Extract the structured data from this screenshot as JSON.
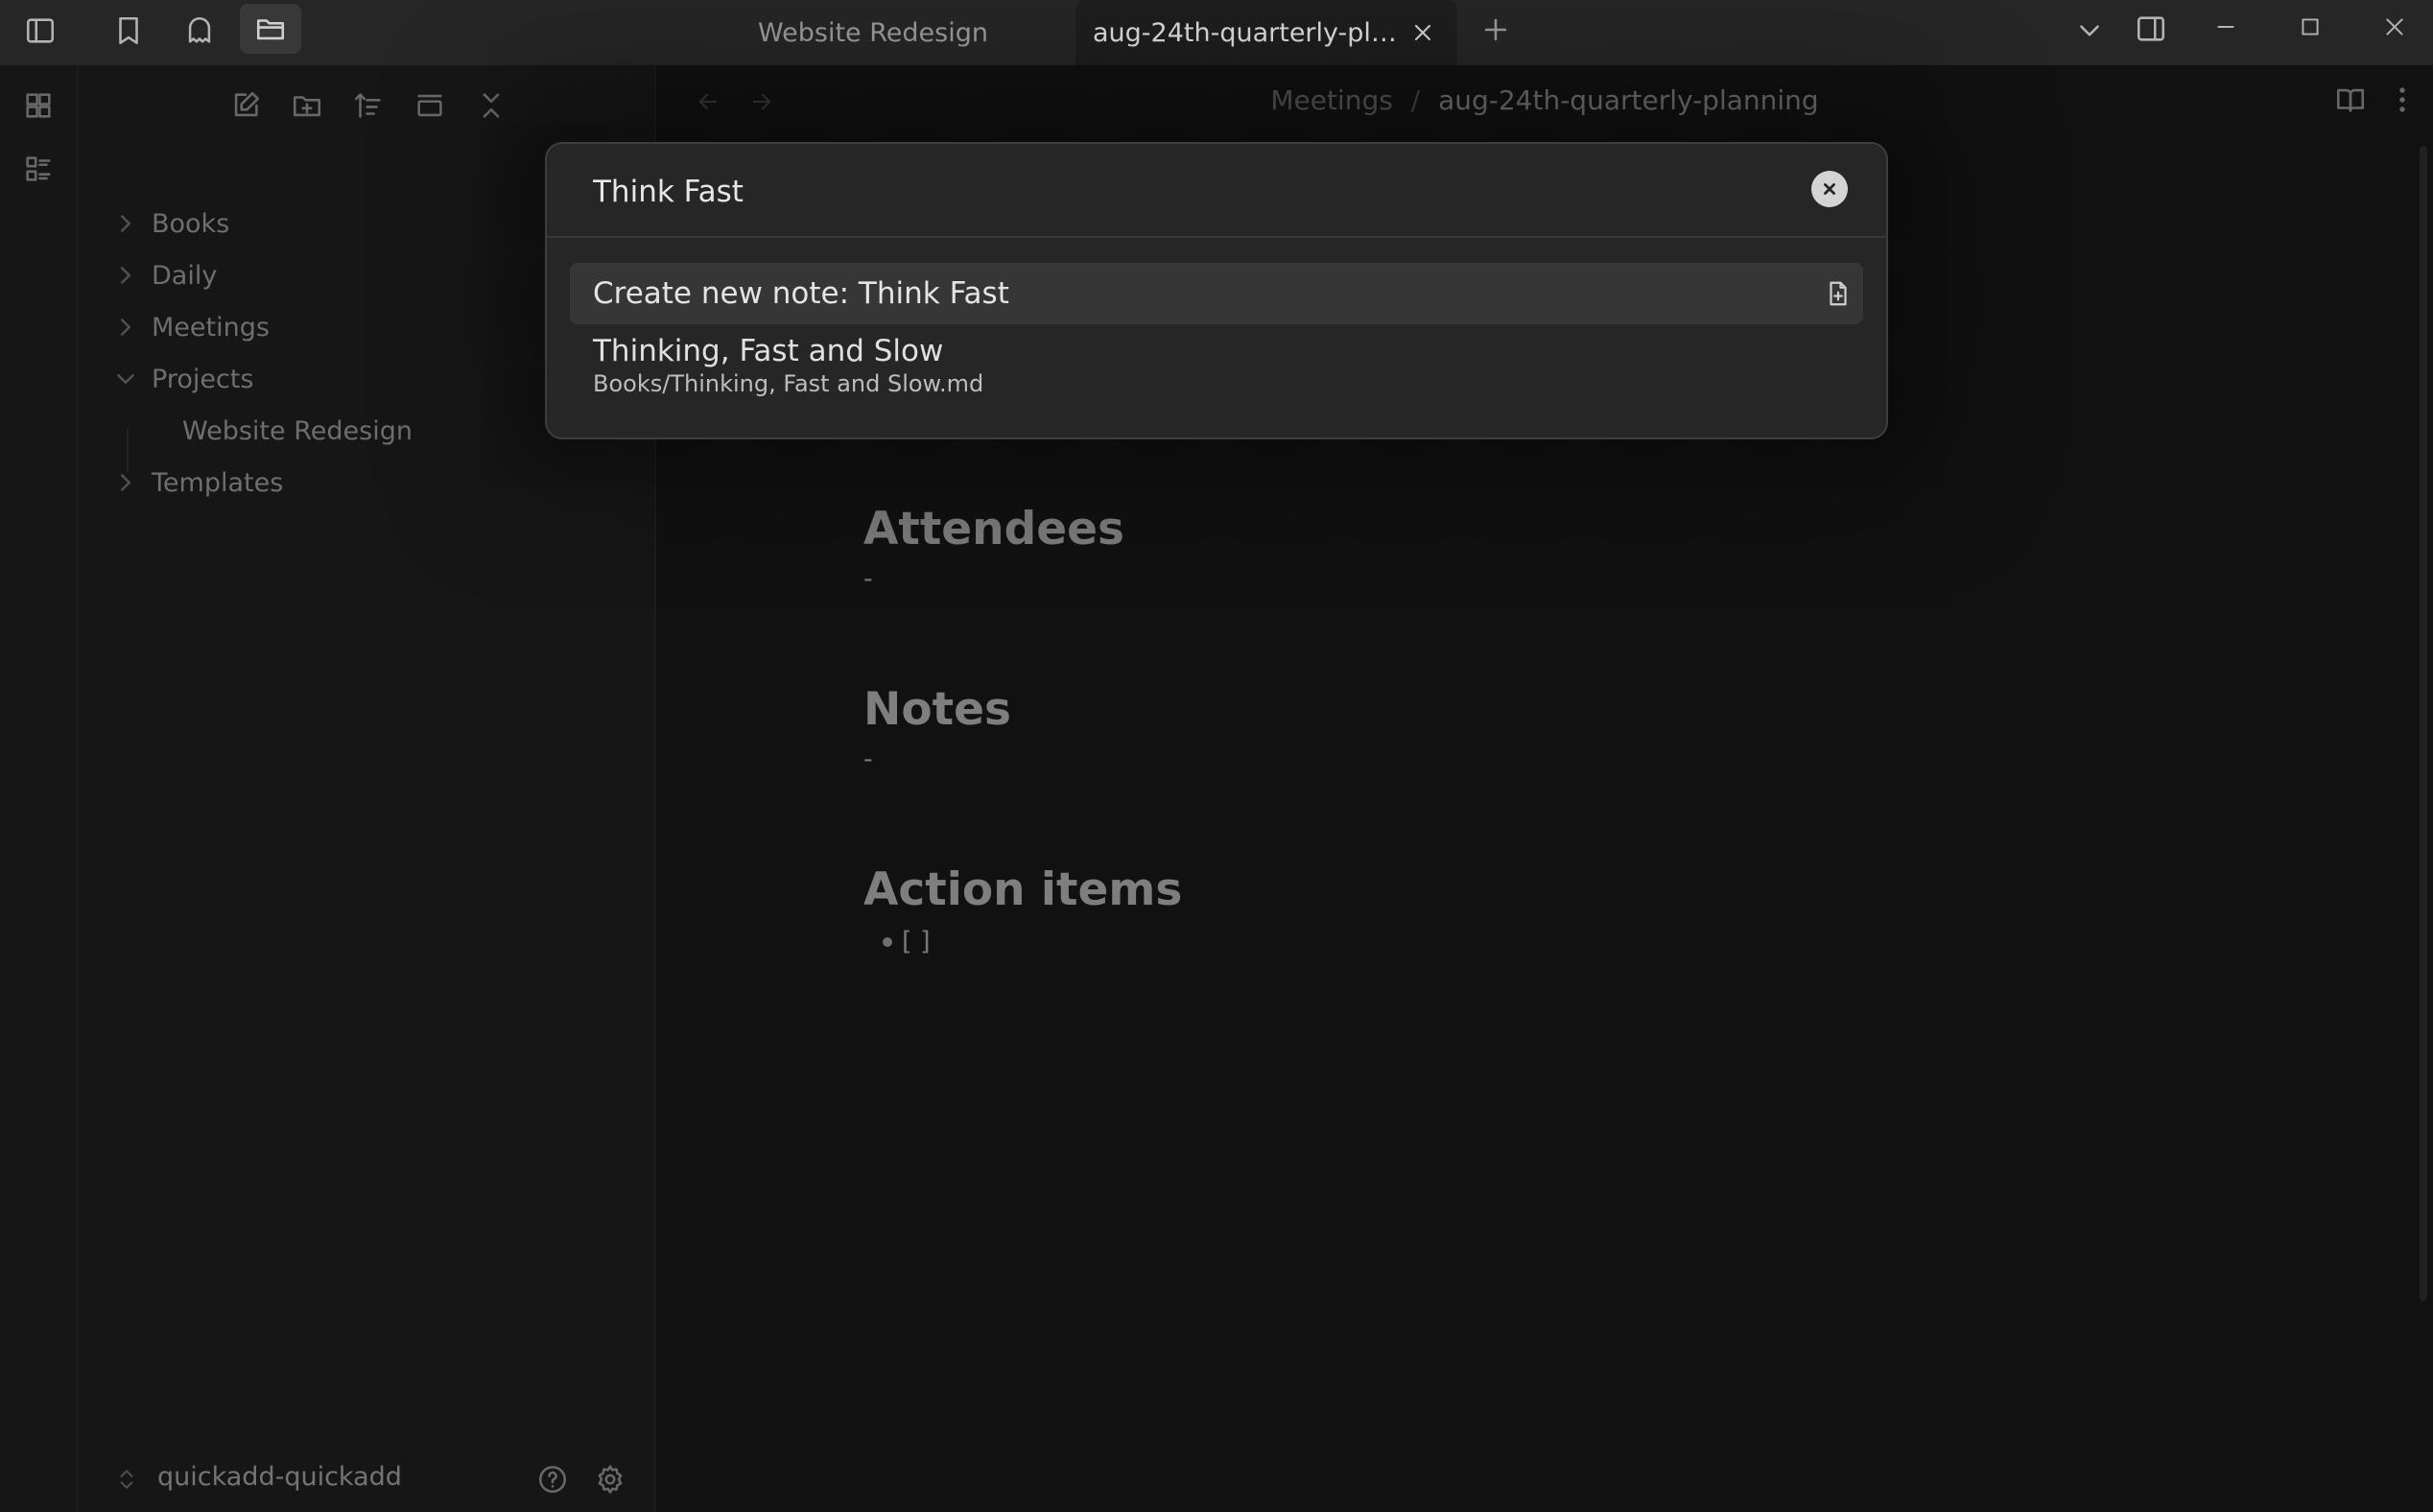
{
  "tabs": {
    "inactive_label": "Website Redesign",
    "active_label": "aug-24th-quarterly-planning"
  },
  "sidebar": {
    "items": [
      {
        "label": "Books",
        "expanded": false
      },
      {
        "label": "Daily",
        "expanded": false
      },
      {
        "label": "Meetings",
        "expanded": false
      },
      {
        "label": "Projects",
        "expanded": true
      },
      {
        "label": "Website Redesign",
        "child": true
      },
      {
        "label": "Templates",
        "expanded": false
      }
    ],
    "vault_name": "quickadd-quickadd"
  },
  "breadcrumb": {
    "folder": "Meetings",
    "separator": "/",
    "current": "aug-24th-quarterly-planning"
  },
  "note": {
    "sections": [
      {
        "heading": "Attendees",
        "content": "-"
      },
      {
        "heading": "Notes",
        "content": "-"
      },
      {
        "heading": "Action items",
        "content": "[ ]"
      }
    ]
  },
  "modal": {
    "query": "Think Fast",
    "suggestions": [
      {
        "title": "Create new note: Think Fast",
        "icon": "file-plus-icon",
        "selected": true
      },
      {
        "title": "Thinking, Fast and Slow",
        "path": "Books/Thinking, Fast and Slow.md"
      }
    ]
  },
  "colors": {
    "background": "#1e1e1e",
    "sidebar": "#262626",
    "selected_suggestion": "#363636",
    "text": "#dadada"
  }
}
